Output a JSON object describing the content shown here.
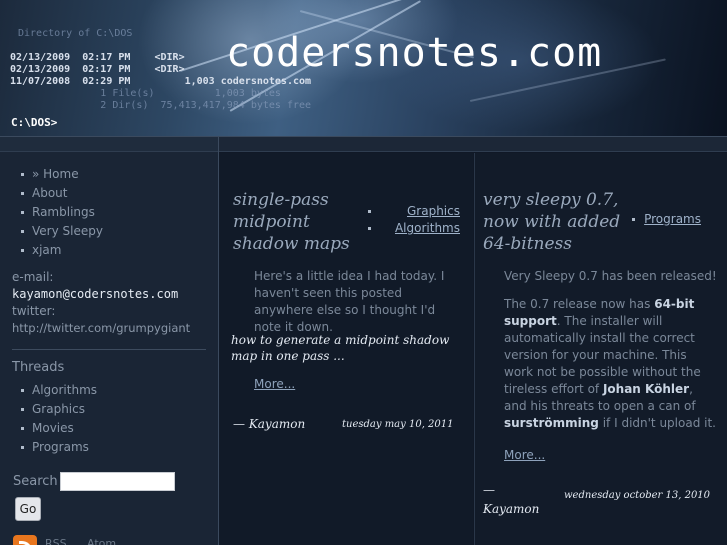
{
  "header": {
    "site_title": "codersnotes.com",
    "dos_listing": {
      "directory_line": "Directory of C:\\DOS",
      "rows": [
        "02/13/2009  02:17 PM    <DIR>",
        "02/13/2009  02:17 PM    <DIR>",
        "11/07/2008  02:29 PM         1,003 codersnotes.com",
        "               1 File(s)          1,003 bytes",
        "               2 Dir(s)  75,413,417,984 bytes free"
      ]
    },
    "prompt": "C:\\DOS>"
  },
  "sidebar": {
    "nav": [
      {
        "label": "» Home"
      },
      {
        "label": "About"
      },
      {
        "label": "Ramblings"
      },
      {
        "label": "Very Sleepy"
      },
      {
        "label": "xjam"
      }
    ],
    "email_label": "e-mail:",
    "email_value": "kayamon@codersnotes.com",
    "twitter_label": "twitter:",
    "twitter_link": "http://twitter.com/grumpygiant",
    "threads_title": "Threads",
    "threads": [
      {
        "label": "Algorithms"
      },
      {
        "label": "Graphics"
      },
      {
        "label": "Movies"
      },
      {
        "label": "Programs"
      }
    ],
    "search_label": "Search",
    "search_value": "",
    "go_label": "Go",
    "feeds": {
      "rss": "RSS",
      "atom": "Atom"
    }
  },
  "posts": [
    {
      "title": "single-pass midpoint shadow maps",
      "categories": [
        "Graphics",
        "Algorithms"
      ],
      "body": "Here's a little idea I had today. I haven't seen this posted anywhere else so I thought I'd note it down.",
      "teaser": "how to generate a midpoint shadow map in one pass ...",
      "more": "More...",
      "author": "— Kayamon",
      "date": "tuesday may 10, 2011"
    },
    {
      "title": "very sleepy 0.7, now with added 64-bitness",
      "categories": [
        "Programs"
      ],
      "body1": "Very Sleepy 0.7 has been released!",
      "body2": {
        "t1": "The 0.7 release now has ",
        "b1": "64-bit support",
        "t2": ". The installer will automatically install the correct version for your machine. This work not be possible without the tireless effort of ",
        "b2": "Johan Köhler",
        "t3": ", and his threats to open a can of ",
        "b3": "surströmming",
        "t4": " if I didn't upload it."
      },
      "more": "More...",
      "author": "— Kayamon",
      "date": "wednesday october 13, 2010"
    }
  ]
}
